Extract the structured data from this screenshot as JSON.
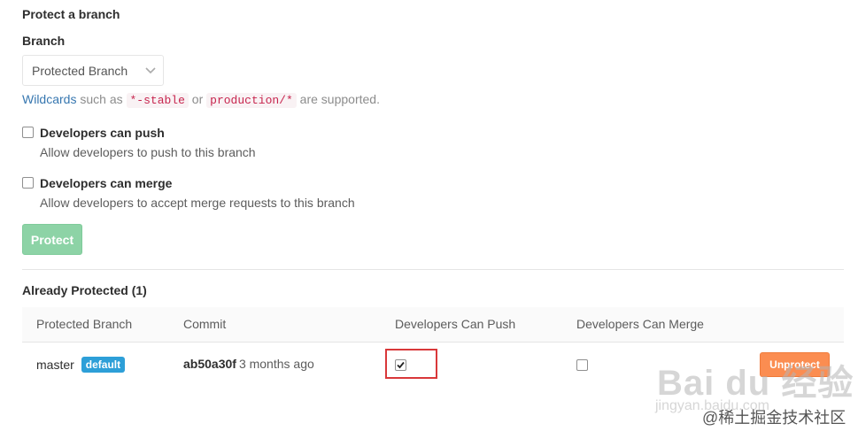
{
  "form": {
    "title": "Protect a branch",
    "branch_label": "Branch",
    "branch_select_value": "Protected Branch",
    "help": {
      "link": "Wildcards",
      "text1": " such as ",
      "code1": "*-stable",
      "text2": " or ",
      "code2": "production/*",
      "text3": " are supported."
    },
    "push": {
      "title": "Developers can push",
      "desc": "Allow developers to push to this branch",
      "checked": false
    },
    "merge": {
      "title": "Developers can merge",
      "desc": "Allow developers to accept merge requests to this branch",
      "checked": false
    },
    "protect_button": "Protect"
  },
  "protected": {
    "title": "Already Protected (1)",
    "headers": [
      "Protected Branch",
      "Commit",
      "Developers Can Push",
      "Developers Can Merge"
    ],
    "rows": [
      {
        "branch": "master",
        "badge": "default",
        "commit_sha": "ab50a30f",
        "commit_time": "3 months ago",
        "can_push": true,
        "can_merge": false,
        "unprotect_label": "Unprotect"
      }
    ]
  },
  "watermark": {
    "logo": "Bai du 经验",
    "url": "jingyan.baidu.com",
    "juejin": "@稀土掘金技术社区"
  },
  "colors": {
    "link": "#3777b0",
    "protect_button": "#8dd3a6",
    "badge": "#2d9fd8",
    "unprotect_button": "#fb8d51",
    "highlight_box": "#d9383a"
  }
}
